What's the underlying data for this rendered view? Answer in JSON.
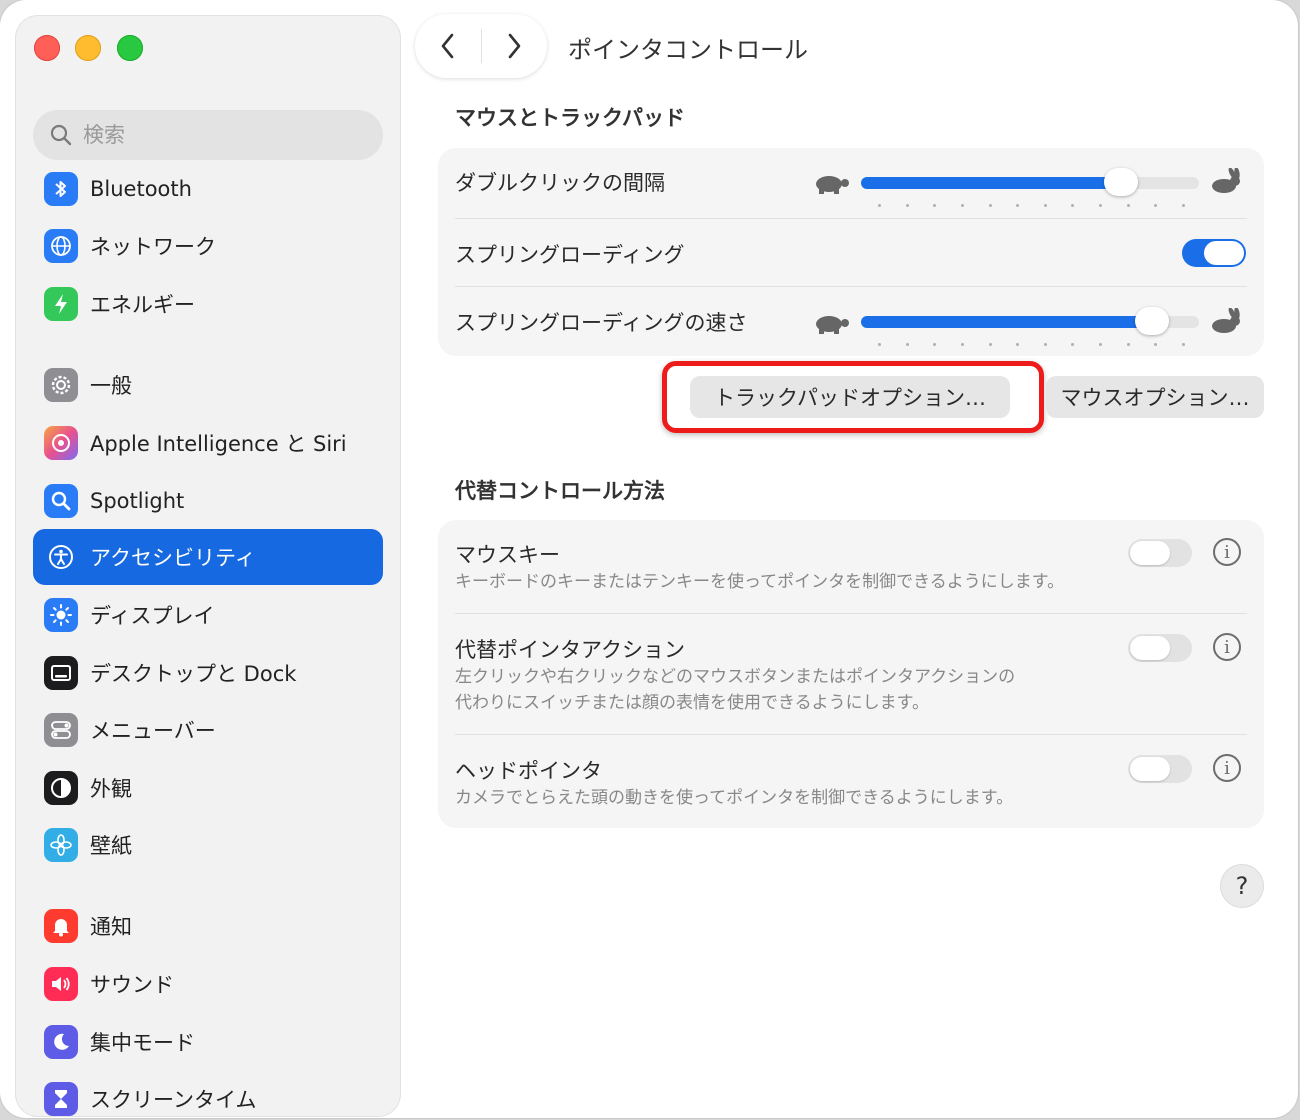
{
  "window": {
    "title": "ポインタコントロール"
  },
  "sidebar": {
    "search_placeholder": "検索",
    "items": [
      {
        "label": "Bluetooth",
        "icon": "bluetooth-icon",
        "color": "#2a7cf6"
      },
      {
        "label": "ネットワーク",
        "icon": "globe-icon",
        "color": "#2a7cf6"
      },
      {
        "label": "エネルギー",
        "icon": "bolt-icon",
        "color": "#34c759"
      },
      {
        "label": "一般",
        "icon": "gear-icon",
        "color": "#8e8e93"
      },
      {
        "label": "Apple Intelligence と Siri",
        "icon": "siri-icon",
        "color": "#e07ad7"
      },
      {
        "label": "Spotlight",
        "icon": "magnifier-icon",
        "color": "#2a7cf6"
      },
      {
        "label": "アクセシビリティ",
        "icon": "accessibility-icon",
        "color": "#1669e0",
        "selected": true
      },
      {
        "label": "ディスプレイ",
        "icon": "sun-icon",
        "color": "#2a7cf6"
      },
      {
        "label": "デスクトップと Dock",
        "icon": "dock-icon",
        "color": "#1c1c1e"
      },
      {
        "label": "メニューバー",
        "icon": "toggle-icon",
        "color": "#8e8e93"
      },
      {
        "label": "外観",
        "icon": "appearance-icon",
        "color": "#1c1c1e"
      },
      {
        "label": "壁紙",
        "icon": "flower-icon",
        "color": "#32ade6"
      },
      {
        "label": "通知",
        "icon": "bell-icon",
        "color": "#ff3b30"
      },
      {
        "label": "サウンド",
        "icon": "speaker-icon",
        "color": "#ff2d55"
      },
      {
        "label": "集中モード",
        "icon": "moon-icon",
        "color": "#5e5ce6"
      },
      {
        "label": "スクリーンタイム",
        "icon": "hourglass-icon",
        "color": "#5e5ce6"
      }
    ]
  },
  "main": {
    "section1_title": "マウスとトラックパッド",
    "double_click_label": "ダブルクリックの間隔",
    "double_click_value": 0.77,
    "spring_loading_label": "スプリングローディング",
    "spring_loading_on": true,
    "spring_speed_label": "スプリングローディングの速さ",
    "spring_speed_value": 0.86,
    "trackpad_options_label": "トラックパッドオプション…",
    "mouse_options_label": "マウスオプション…",
    "section2_title": "代替コントロール方法",
    "mouse_keys": {
      "label": "マウスキー",
      "desc": "キーボードのキーまたはテンキーを使ってポインタを制御できるようにします。",
      "on": false
    },
    "alt_pointer": {
      "label": "代替ポインタアクション",
      "desc1": "左クリックや右クリックなどのマウスボタンまたはポインタアクションの",
      "desc2": "代わりにスイッチまたは顔の表情を使用できるようにします。",
      "on": false
    },
    "head_pointer": {
      "label": "ヘッドポインタ",
      "desc": "カメラでとらえた頭の動きを使ってポインタを制御できるようにします。",
      "on": false
    },
    "help_label": "?"
  }
}
